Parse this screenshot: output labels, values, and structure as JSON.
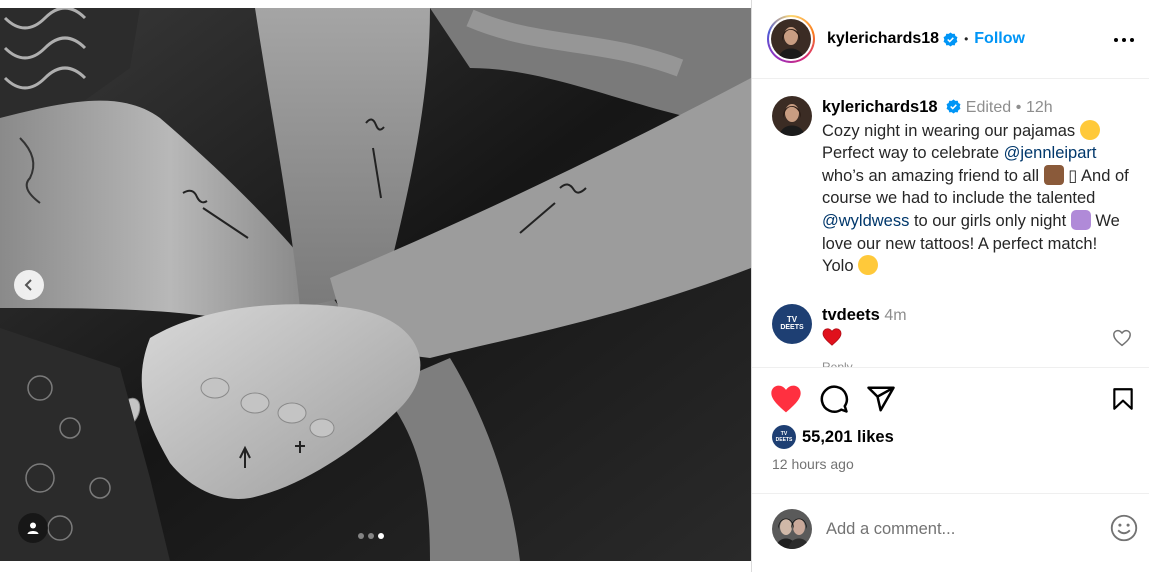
{
  "post": {
    "username": "kylerichards18",
    "follow_label": "Follow",
    "separator": "•",
    "carousel": {
      "dot_count": 3,
      "active_index": 2
    }
  },
  "caption": {
    "username": "kylerichards18",
    "edited": "Edited",
    "sep": "•",
    "age": "12h",
    "line1": "Cozy night in wearing our pajamas",
    "line2a": "Perfect way to celebrate ",
    "mention1": "@jennleipart",
    "line2b": " who’s an amazing friend to all",
    "box_char": "▯",
    "line3a": " And of course we had to include the talented ",
    "mention2": "@wyldwess",
    "line3b": " to our girls only night",
    "line3c": " We love our new tattoos! A perfect match! Yolo",
    "emoji_names": [
      "smiling-face-with-hearts",
      "cake",
      "woman-shrugging",
      "winking-tongue"
    ]
  },
  "comment": {
    "avatar_line1": "TV",
    "avatar_line2": "DEETS",
    "username": "tvdeets",
    "age": "4m",
    "body_icon": "red-heart",
    "reply_partial": "Reply"
  },
  "likes": {
    "avatar_line1": "TV",
    "avatar_line2": "DEETS",
    "count_text": "55,201 likes"
  },
  "timestamp": "12 hours ago",
  "add_comment": {
    "placeholder": "Add a comment..."
  },
  "colors": {
    "accent": "#0095f6",
    "like_red": "#ff3040",
    "verified_blue": "#0095f6",
    "tv_navy": "#1e3f73",
    "mention": "#00376b"
  }
}
